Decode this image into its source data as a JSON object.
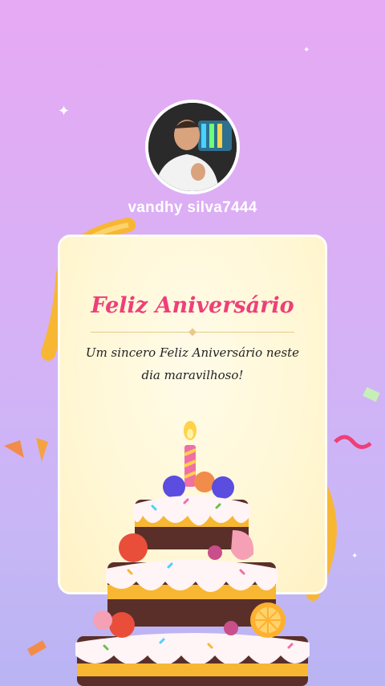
{
  "profile": {
    "username": "vandhy silva7444"
  },
  "card": {
    "title": "Feliz Aniversário",
    "message": "Um sincero Feliz Aniversário neste dia maravilhoso!"
  },
  "colors": {
    "title": "#ee3f79",
    "background_top": "#e6a9f3",
    "background_bottom": "#b9b4f3",
    "card": "#fff7d5"
  },
  "icons": [
    "sparkle-icon",
    "ribbon-icon",
    "confetti-icon",
    "cake-illustration",
    "candle-icon"
  ]
}
